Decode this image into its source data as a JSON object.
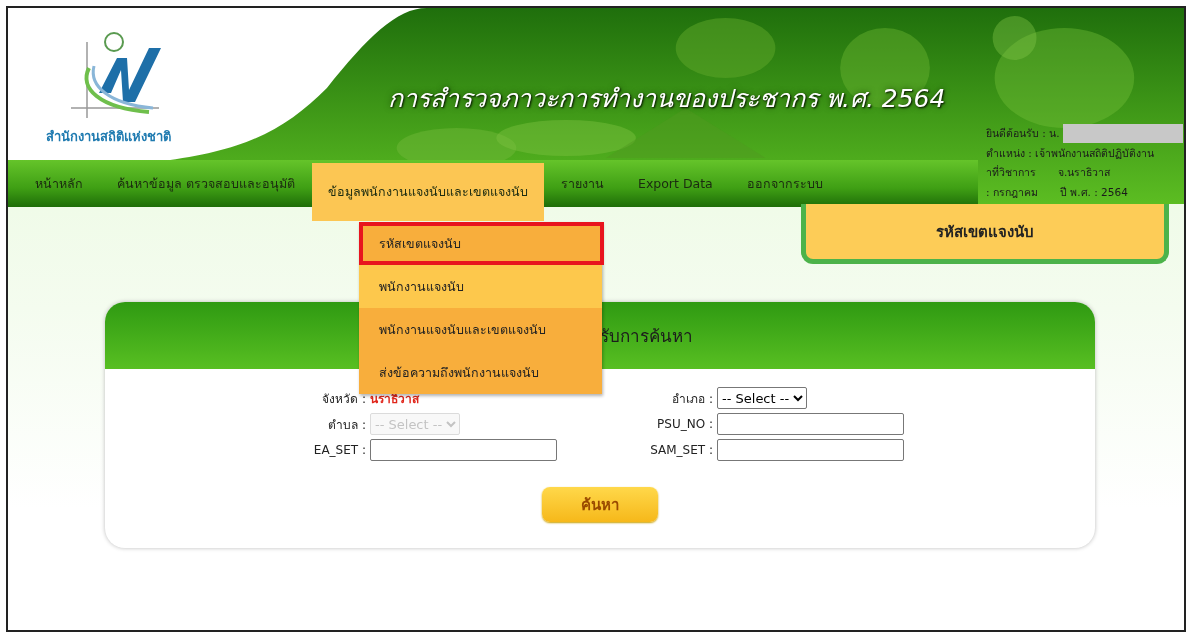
{
  "header": {
    "org_name": "สำนักงานสถิติแห่งชาติ",
    "title": "การสำรวจภาวะการทำงานของประชากร พ.ศ. 2564",
    "user_info": [
      {
        "kind": "welcome",
        "text": "ยินดีต้อนรับ : น."
      },
      {
        "kind": "line",
        "text": "ตำแหน่ง : เจ้าพนักงานสถิติปฏิบัติงาน"
      },
      {
        "kind": "split",
        "text": "าที่วิชาการ",
        "extra": "จ.นราธิวาส"
      },
      {
        "kind": "split",
        "text": ": กรกฎาคม",
        "extra": "ปี พ.ศ. : 2564"
      }
    ]
  },
  "nav": {
    "items": [
      {
        "label": "หน้าหลัก",
        "selected": false
      },
      {
        "label": "ค้นหาข้อมูล ตรวจสอบและอนุมัติ",
        "selected": false
      },
      {
        "label": "ข้อมูลพนักงานแจงนับและเขตแจงนับ",
        "selected": true
      },
      {
        "label": "รายงาน",
        "selected": false
      },
      {
        "label": "Export Data",
        "selected": false
      },
      {
        "label": "ออกจากระบบ",
        "selected": false
      }
    ]
  },
  "dropdown": {
    "items": [
      {
        "label": "รหัสเขตแจงนับ",
        "selected": true,
        "color": "#f8ae3c"
      },
      {
        "label": "พนักงานแจงนับ",
        "selected": false,
        "color": "#fdc84c"
      },
      {
        "label": "พนักงานแจงนับและเขตแจงนับ",
        "selected": false,
        "color": "#f8ae3c"
      },
      {
        "label": "ส่งข้อความถึงพนักงานแจงนับ",
        "selected": false,
        "color": "#f8ae3c"
      }
    ]
  },
  "page_heading": "รหัสเขตแจงนับ",
  "search": {
    "title": "รับการค้นหา",
    "fields": [
      {
        "label": "จังหวัด :",
        "kind": "value",
        "value": "นราธิวาส"
      },
      {
        "label": "อำเภอ :",
        "kind": "select",
        "value": "-- Select --",
        "disabled": false
      },
      {
        "label": "ตำบล :",
        "kind": "select",
        "value": "-- Select --",
        "disabled": true
      },
      {
        "label": "PSU_NO :",
        "kind": "input"
      },
      {
        "label": "EA_SET :",
        "kind": "input"
      },
      {
        "label": "SAM_SET :",
        "kind": "input"
      }
    ],
    "button": "ค้นหา"
  }
}
